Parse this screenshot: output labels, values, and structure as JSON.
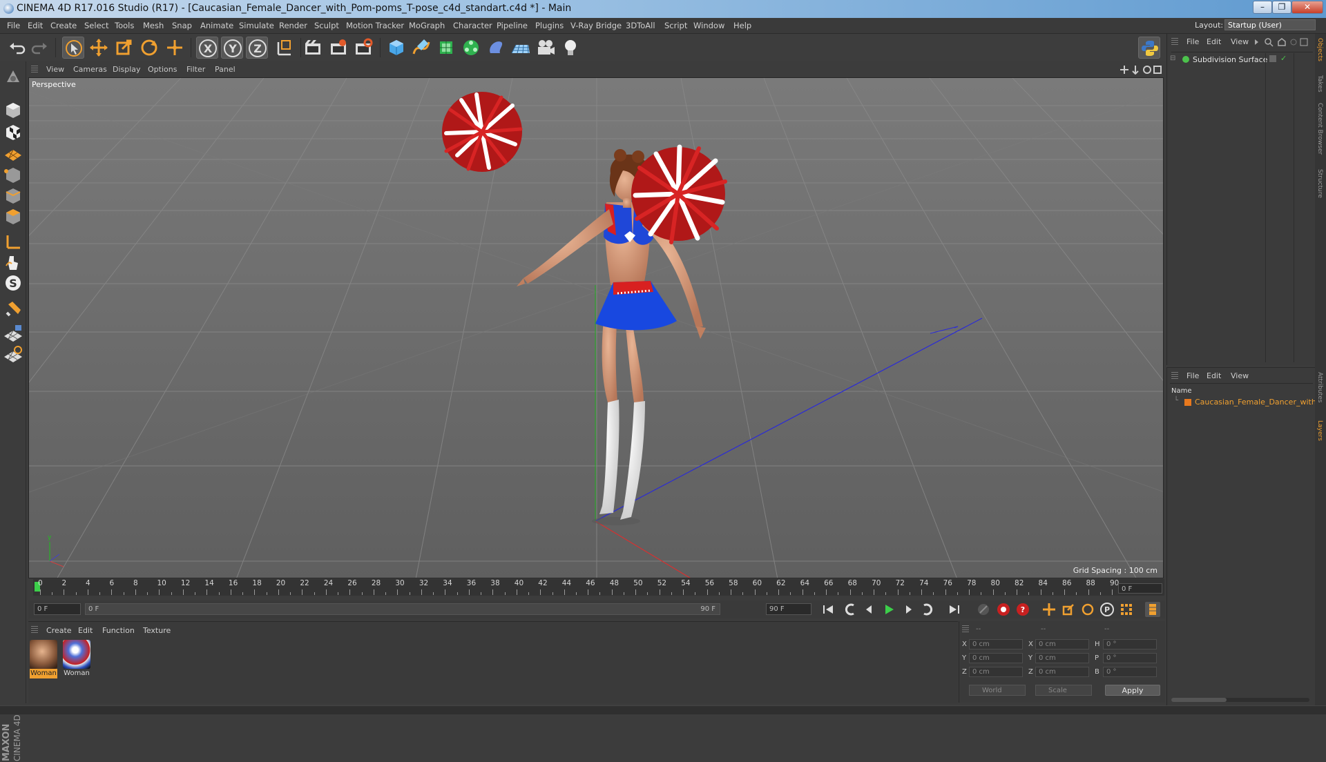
{
  "window": {
    "title": "CINEMA 4D R17.016 Studio (R17) - [Caucasian_Female_Dancer_with_Pom-poms_T-pose_c4d_standart.c4d *] - Main",
    "buttons": [
      "–",
      "❐",
      "✕"
    ]
  },
  "menubar": {
    "items": [
      "File",
      "Edit",
      "Create",
      "Select",
      "Tools",
      "Mesh",
      "Snap",
      "Animate",
      "Simulate",
      "Render",
      "Sculpt",
      "Motion Tracker",
      "MoGraph",
      "Character",
      "Pipeline",
      "Plugins",
      "V-Ray Bridge",
      "3DToAll",
      "Script",
      "Window",
      "Help"
    ],
    "layout_label": "Layout:",
    "layout_value": "Startup (User)"
  },
  "toolbar": {
    "icons": [
      "undo-icon",
      "redo-icon",
      "select-arrow-icon",
      "move-icon",
      "scale-icon",
      "rotate-icon",
      "live-select-icon",
      "x-axis-icon",
      "y-axis-icon",
      "z-axis-icon",
      "coordinate-system-icon",
      "render-view-icon",
      "render-picture-viewer-icon",
      "edit-render-settings-icon",
      "cube-primitive-icon",
      "pen-spline-icon",
      "subdivision-icon",
      "mograph-cloner-icon",
      "deformer-icon",
      "floor-icon",
      "camera-icon",
      "light-icon",
      "python-icon"
    ]
  },
  "viewport": {
    "menu": [
      "View",
      "Cameras",
      "Display",
      "Options",
      "Filter",
      "Panel"
    ],
    "label": "Perspective",
    "grid_spacing": "Grid Spacing : 100 cm"
  },
  "timeline": {
    "ticks": [
      "0",
      "2",
      "4",
      "6",
      "8",
      "10",
      "12",
      "14",
      "16",
      "18",
      "20",
      "22",
      "24",
      "26",
      "28",
      "30",
      "32",
      "34",
      "36",
      "38",
      "40",
      "42",
      "44",
      "46",
      "48",
      "50",
      "52",
      "54",
      "56",
      "58",
      "60",
      "62",
      "64",
      "66",
      "68",
      "70",
      "72",
      "74",
      "76",
      "78",
      "80",
      "82",
      "84",
      "86",
      "88",
      "90"
    ],
    "current_frame": "0 F",
    "start_field": "0 F",
    "range_start": "0 F",
    "range_end": "90 F",
    "end_field": "90 F"
  },
  "materials": {
    "menu": [
      "Create",
      "Edit",
      "Function",
      "Texture"
    ],
    "items": [
      {
        "name": "Woman",
        "color": "#8a5a3c"
      },
      {
        "name": "Woman",
        "color": "#2a4fbf"
      }
    ]
  },
  "coordinates": {
    "headers": [
      "--",
      "--",
      "--"
    ],
    "rows": [
      {
        "a": "X",
        "a_val": "0 cm",
        "b": "X",
        "b_val": "0 cm",
        "c": "H",
        "c_val": "0 °"
      },
      {
        "a": "Y",
        "a_val": "0 cm",
        "b": "Y",
        "b_val": "0 cm",
        "c": "P",
        "c_val": "0 °"
      },
      {
        "a": "Z",
        "a_val": "0 cm",
        "b": "Z",
        "b_val": "0 cm",
        "c": "B",
        "c_val": "0 °"
      }
    ],
    "mode": "World",
    "scale": "Scale",
    "apply": "Apply"
  },
  "object_manager": {
    "menu": [
      "File",
      "Edit",
      "View"
    ],
    "object": "Subdivision Surface"
  },
  "layer_manager": {
    "menu": [
      "File",
      "Edit",
      "View"
    ],
    "column": "Name",
    "object": "Caucasian_Female_Dancer_with_P"
  },
  "side_tabs": [
    "Objects",
    "Takes",
    "Content Browser",
    "Structure",
    "Attributes",
    "Layers"
  ],
  "branding": {
    "maxon": "MAXON",
    "c4d": "CINEMA 4D"
  },
  "colors": {
    "accent_orange": "#f0a030",
    "object_green": "#4cc24c",
    "layer_orange": "#e8791e"
  }
}
